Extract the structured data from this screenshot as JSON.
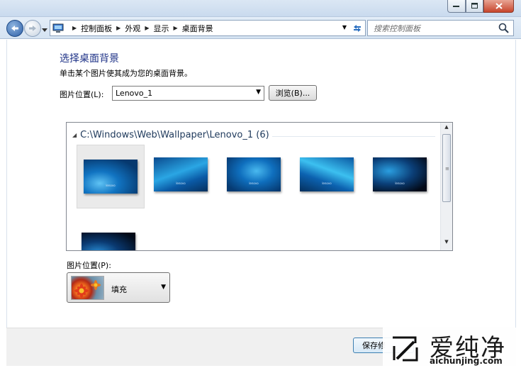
{
  "window": {
    "caption_buttons": [
      "minimize",
      "maximize",
      "close"
    ]
  },
  "address_bar": {
    "breadcrumbs": [
      "控制面板",
      "外观",
      "显示",
      "桌面背景"
    ],
    "search_placeholder": "搜索控制面板"
  },
  "page": {
    "title": "选择桌面背景",
    "description": "单击某个图片使其成为您的桌面背景。",
    "location_label": "图片位置(L):",
    "location_value": "Lenovo_1",
    "browse_label": "浏览(B)..."
  },
  "gallery": {
    "group_title": "C:\\Windows\\Web\\Wallpaper\\Lenovo_1 (6)",
    "selected_index": 0,
    "thumbnail_caption": "lenovo"
  },
  "position": {
    "label": "图片位置(P):",
    "value": "填充"
  },
  "footer": {
    "save_label": "保存修"
  },
  "watermark": {
    "chinese": "爱纯净",
    "url": "aichunjing.com"
  },
  "colors": {
    "title_blue": "#1e3287",
    "close_red": "#c7452c"
  }
}
